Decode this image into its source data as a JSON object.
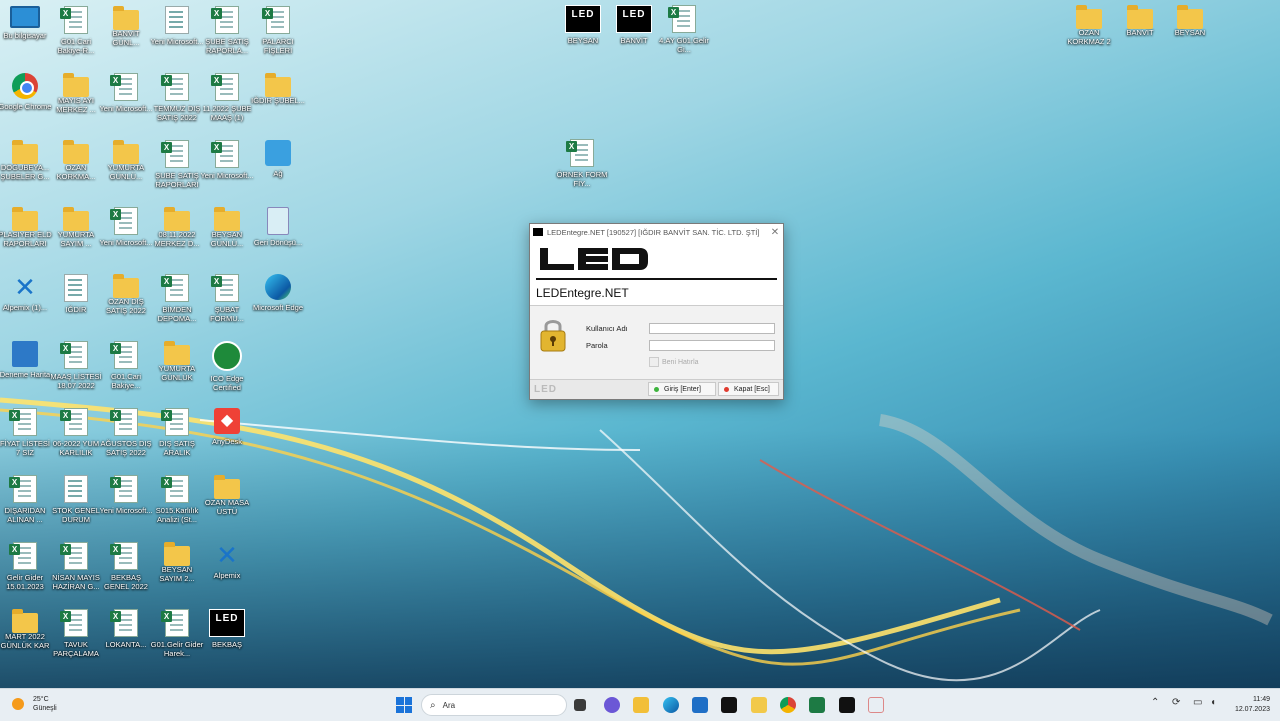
{
  "desktop": {
    "icons": [
      {
        "label": "Bu bilgisayar",
        "type": "pc"
      },
      {
        "label": "G01.Cari Bakiye-R...",
        "type": "xls"
      },
      {
        "label": "BANVİT GÜNL...",
        "type": "folder"
      },
      {
        "label": "Yeni Microsoft...",
        "type": "doc"
      },
      {
        "label": "ŞUBE SATIŞ RAPORLA...",
        "type": "xls"
      },
      {
        "label": "PALARCI FİŞLERİ",
        "type": "xls"
      },
      {
        "label": "Google Chrome",
        "type": "chrome"
      },
      {
        "label": "MAYIS AYI MERKEZ ...",
        "type": "folder"
      },
      {
        "label": "Yeni Microsoft...",
        "type": "xls"
      },
      {
        "label": "TEMMUZ DIŞ SATIŞ 2022",
        "type": "xls"
      },
      {
        "label": "11.2022 ŞUBE MAAŞ (1)",
        "type": "xls"
      },
      {
        "label": "IĞDIR ŞUBEL...",
        "type": "folder"
      },
      {
        "label": "DOĞUBEYA... ŞUBELER G...",
        "type": "folder"
      },
      {
        "label": "OZAN KORKMA...",
        "type": "folder"
      },
      {
        "label": "YUMURTA GÜNLÜ...",
        "type": "folder"
      },
      {
        "label": "ŞUBE SATIŞ RAPORLARI",
        "type": "xls"
      },
      {
        "label": "Yeni Microsoft...",
        "type": "xls"
      },
      {
        "label": "Ağ",
        "type": "net"
      },
      {
        "label": "PLASİYER ELD RAPORLARI",
        "type": "folder"
      },
      {
        "label": "YUMURTA SAYIM ...",
        "type": "folder"
      },
      {
        "label": "Yeni Microsoft...",
        "type": "xls"
      },
      {
        "label": "08.11.2022 MERKEZ D...",
        "type": "folder"
      },
      {
        "label": "BEYSAN GÜNLÜ...",
        "type": "folder"
      },
      {
        "label": "Geri Dönüşü...",
        "type": "bin"
      },
      {
        "label": "Alpemix (1)...",
        "type": "alp"
      },
      {
        "label": "IĞDIR",
        "type": "doc"
      },
      {
        "label": "OZAN DIŞ SATIŞ 2022",
        "type": "folder"
      },
      {
        "label": "BİMDEN DEPOMA...",
        "type": "xls"
      },
      {
        "label": "ŞUBAT FORMU...",
        "type": "xls"
      },
      {
        "label": "Microsoft Edge",
        "type": "edge"
      },
      {
        "label": "Deneme Harita",
        "type": "deneme"
      },
      {
        "label": "MAAŞ LİSTESİ 18.07.2022",
        "type": "xls"
      },
      {
        "label": "G01.Cari Bakiye...",
        "type": "xls"
      },
      {
        "label": "YUMURTA GÜNLÜK",
        "type": "folder"
      },
      {
        "label": "ICO Edge Certified",
        "type": "ico"
      },
      {
        "label": "FİYAT LİSTESİ 7 SIZ",
        "type": "xls"
      },
      {
        "label": "06-2022 YUM KARLILIK",
        "type": "xls"
      },
      {
        "label": "AĞUSTOS DIŞ SATIŞ 2022",
        "type": "xls"
      },
      {
        "label": "DIŞ SATIŞ ARALIK",
        "type": "xls"
      },
      {
        "label": "AnyDesk",
        "type": "any"
      },
      {
        "label": "DIŞARIDAN ALINAN ...",
        "type": "xls"
      },
      {
        "label": "STOK GENEL DURUM",
        "type": "doc"
      },
      {
        "label": "Yeni Microsoft...",
        "type": "xls"
      },
      {
        "label": "S015.Karlılık Analizi (St...",
        "type": "xls"
      },
      {
        "label": "OZAN MASA ÜSTÜ",
        "type": "folder"
      },
      {
        "label": "Gelir Gider 15.01.2023",
        "type": "xls"
      },
      {
        "label": "NİSAN MAYIS HAZİRAN G...",
        "type": "xls"
      },
      {
        "label": "BEKBAŞ GENEL 2022",
        "type": "xls"
      },
      {
        "label": "BEYSAN SAYIM 2...",
        "type": "folder"
      },
      {
        "label": "Alpemix",
        "type": "alp"
      },
      {
        "label": "MART 2022 GÜNLÜK KAR",
        "type": "folder"
      },
      {
        "label": "TAVUK PARÇALAMA",
        "type": "xls"
      },
      {
        "label": "LOKANTA...",
        "type": "xls"
      },
      {
        "label": "G01.Gelir Gider Harek...",
        "type": "xls"
      },
      {
        "label": "BEKBAŞ",
        "type": "led"
      },
      {
        "label": "BEYSAN",
        "type": "led"
      },
      {
        "label": "BANVİT",
        "type": "led"
      },
      {
        "label": "4.AY G01.Gelir Gi...",
        "type": "xls"
      },
      {
        "label": "ÖRNEK FORM FİY...",
        "type": "xls"
      },
      {
        "label": "OZAN KORKMAZ 2",
        "type": "folder"
      },
      {
        "label": "BANVİT",
        "type": "folder"
      },
      {
        "label": "BEYSAN",
        "type": "folder"
      }
    ]
  },
  "login": {
    "title": "LEDEntegre.NET [190527] [IĞDIR BANVİT SAN. TİC. LTD. ŞTİ]",
    "product": "LEDEntegre.NET",
    "username_label": "Kullanıcı Adı",
    "password_label": "Parola",
    "username_value": "",
    "password_value": "",
    "remember_label": "Beni Hatırla",
    "login_button": "Giriş [Enter]",
    "close_button": "Kapat [Esc]",
    "footer_logo": "LED"
  },
  "taskbar": {
    "weather_temp": "25°C",
    "weather_desc": "Güneşli",
    "search_placeholder": "Ara",
    "time": "11:49",
    "date": "12.07.2023"
  },
  "colors": {
    "login_green": "#3db43d",
    "close_red": "#e03b2f",
    "start_blue": "#1a73d9"
  }
}
